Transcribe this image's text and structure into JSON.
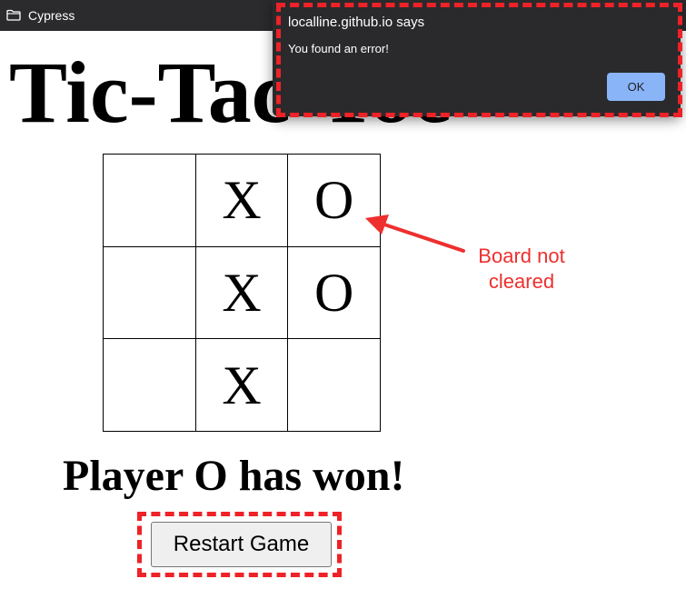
{
  "window": {
    "title": "Cypress",
    "icon": "folder-icon"
  },
  "page": {
    "title": "Tic-Tac-Toe",
    "board": [
      [
        "",
        "X",
        "O"
      ],
      [
        "",
        "X",
        "O"
      ],
      [
        "",
        "X",
        ""
      ]
    ],
    "status": "Player O has won!",
    "restart_label": "Restart Game"
  },
  "dialog": {
    "origin": "localline.github.io says",
    "message": "You found an error!",
    "ok_label": "OK"
  },
  "annotation": {
    "line1": "Board not",
    "line2": "cleared",
    "color": "#ee2f2f"
  },
  "colors": {
    "highlight_dash": "#ee2227",
    "ok_button": "#8ab4f8",
    "dialog_bg": "#2a2a2c"
  }
}
